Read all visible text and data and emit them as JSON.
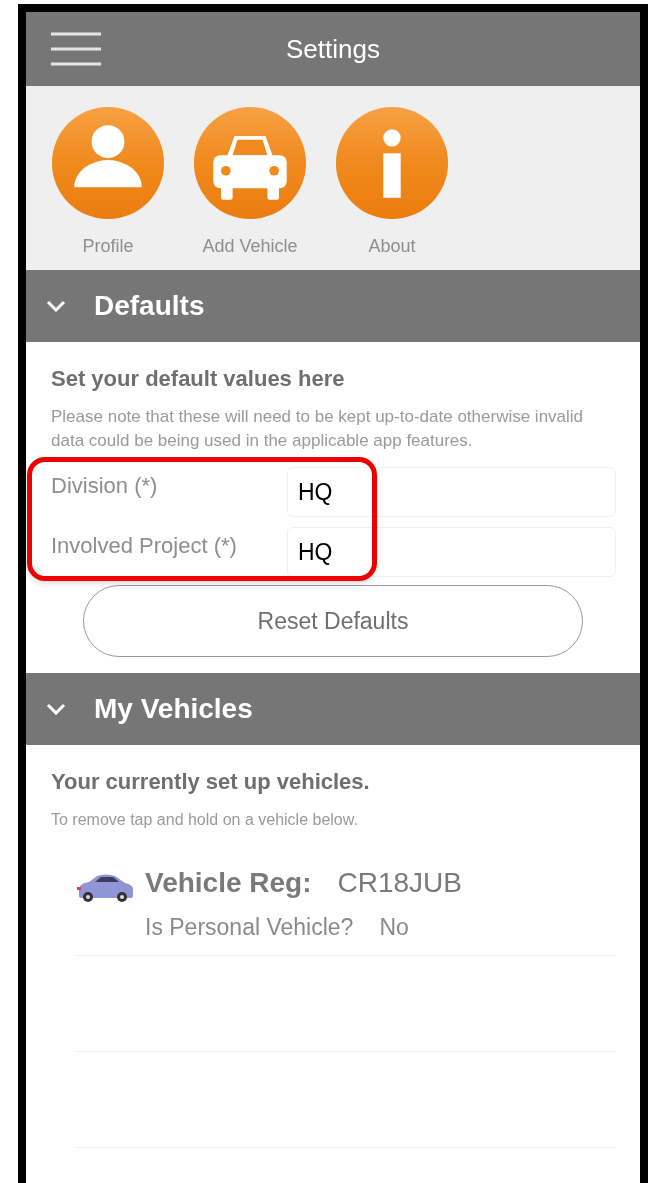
{
  "header": {
    "title": "Settings"
  },
  "shortcuts": [
    {
      "kind": "person",
      "label": "Profile"
    },
    {
      "kind": "car",
      "label": "Add Vehicle"
    },
    {
      "kind": "info",
      "label": "About"
    }
  ],
  "defaults": {
    "title": "Defaults",
    "expanded": true,
    "heading": "Set your default values here",
    "note": "Please note that these will need to be kept up-to-date otherwise invalid data could be being used in the applicable app features.",
    "fields": [
      {
        "label": "Division (*)",
        "value": "HQ"
      },
      {
        "label": "Involved Project (*)",
        "value": "HQ"
      }
    ],
    "reset_button": "Reset Defaults"
  },
  "vehicles": {
    "title": "My Vehicles",
    "expanded": true,
    "heading": "Your currently set up vehicles.",
    "note": "To remove tap and hold on a vehicle below.",
    "items": [
      {
        "reg_label": "Vehicle Reg:",
        "reg": "CR18JUB",
        "personal_label": "Is Personal Vehicle?",
        "personal": "No"
      }
    ]
  }
}
